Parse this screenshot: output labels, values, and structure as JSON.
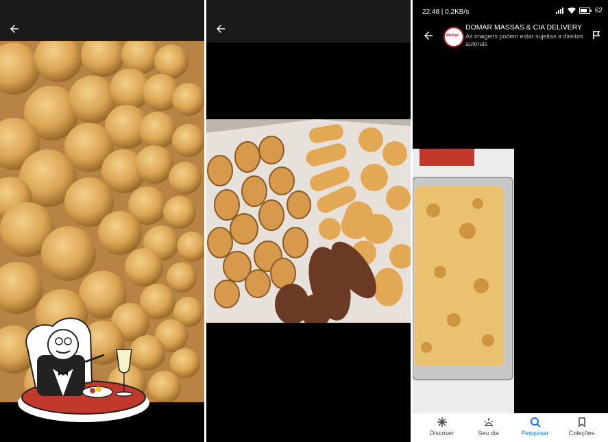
{
  "panel3": {
    "status": {
      "time_speed": "22:48 | 0,2KB/s",
      "battery": "62"
    },
    "header": {
      "logo_text": "domar",
      "title": "DOMAR MASSAS & CIA DELIVERY",
      "subtitle": "As imagens podem estar sujeitas a direitos autorais"
    },
    "bottom_nav": [
      {
        "label": "Discover",
        "icon": "asterisk-icon"
      },
      {
        "label": "Seu dia",
        "icon": "sunrise-icon"
      },
      {
        "label": "Pesquisar",
        "icon": "search-icon",
        "active": true
      },
      {
        "label": "Coleções",
        "icon": "collections-icon"
      }
    ]
  },
  "colors": {
    "accent": "#1a73e8",
    "header_bg": "#1a1a1a",
    "brand_red": "#b71c1c"
  }
}
